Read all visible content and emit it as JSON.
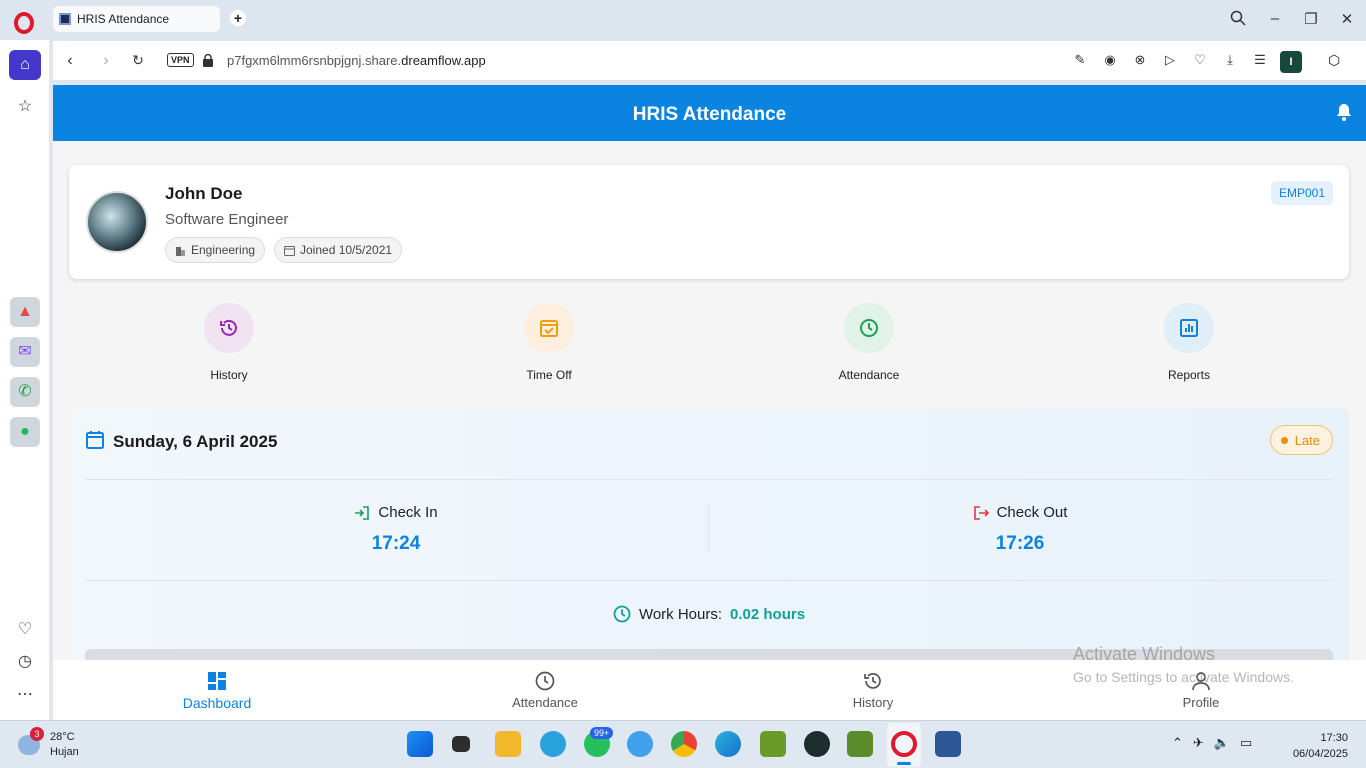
{
  "browser": {
    "tab_title": "HRIS Attendance",
    "url_prefix": "p7fgxm6lmm6rsnbpjgnj.share.",
    "url_domain": "dreamflow.app",
    "vpn_label": "VPN",
    "profile_initial": "I"
  },
  "app": {
    "title": "HRIS Attendance",
    "employee": {
      "name": "John Doe",
      "role": "Software Engineer",
      "department": "Engineering",
      "joined": "Joined 10/5/2021",
      "id": "EMP001"
    },
    "quick_actions": [
      {
        "label": "History",
        "color": "#9c27b0",
        "bg": "#f1e3f2"
      },
      {
        "label": "Time Off",
        "color": "#f39c12",
        "bg": "#fdeedd"
      },
      {
        "label": "Attendance",
        "color": "#1aa05b",
        "bg": "#e1f2e8"
      },
      {
        "label": "Reports",
        "color": "#0a84e0",
        "bg": "#dfeef9"
      }
    ],
    "attendance": {
      "date": "Sunday, 6 April 2025",
      "status": "Late",
      "check_in_label": "Check In",
      "check_in_time": "17:24",
      "check_out_label": "Check Out",
      "check_out_time": "17:26",
      "work_hours_label": "Work Hours:",
      "work_hours_value": "0.02 hours"
    },
    "bottom_nav": [
      {
        "label": "Dashboard",
        "active": true
      },
      {
        "label": "Attendance",
        "active": false
      },
      {
        "label": "History",
        "active": false
      },
      {
        "label": "Profile",
        "active": false
      }
    ]
  },
  "watermark": {
    "line1": "Activate Windows",
    "line2": "Go to Settings to activate Windows."
  },
  "taskbar": {
    "weather_temp": "28°C",
    "weather_cond": "Hujan",
    "weather_badge": "3",
    "whatsapp_badge": "99+",
    "time": "17:30",
    "date": "06/04/2025"
  },
  "colors": {
    "primary": "#0a84e0",
    "late": "#f08c00",
    "work_hours": "#11a09a"
  }
}
